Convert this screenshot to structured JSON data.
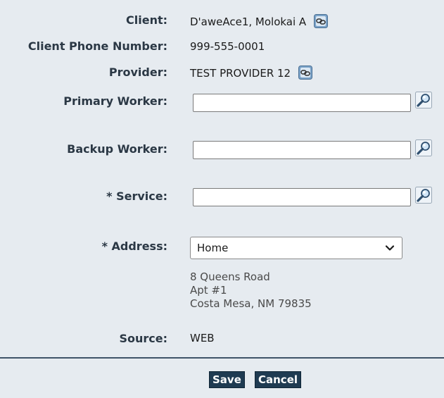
{
  "fields": {
    "client_label": "Client:",
    "client_value": "D'aweAce1, Molokai A",
    "phone_label": "Client Phone Number:",
    "phone_value": "999-555-0001",
    "provider_label": "Provider:",
    "provider_value": "TEST PROVIDER 12",
    "primary_worker_label": "Primary Worker:",
    "primary_worker_value": "",
    "backup_worker_label": "Backup Worker:",
    "backup_worker_value": "",
    "service_label": "* Service:",
    "service_value": "",
    "address_label": "* Address:",
    "address_selected": "Home",
    "address_line1": "8 Queens Road",
    "address_line2": "Apt #1",
    "address_line3": "Costa Mesa, NM 79835",
    "source_label": "Source:",
    "source_value": "WEB"
  },
  "buttons": {
    "save": "Save",
    "cancel": "Cancel"
  },
  "icons": {
    "link": "link-chain-icon",
    "lookup": "magnifier-icon",
    "dropdown": "chevron-down-icon"
  },
  "colors": {
    "background": "#e6ebf0",
    "button": "#1f3b52",
    "divider": "#3f5468"
  }
}
